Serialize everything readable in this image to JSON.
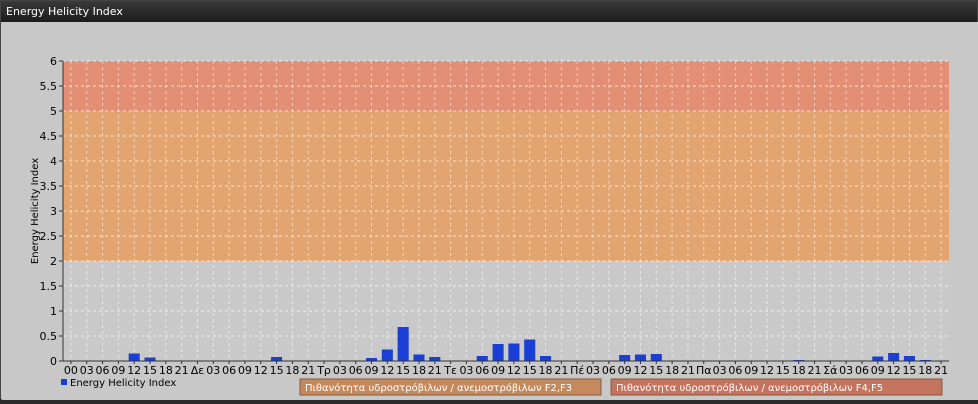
{
  "window": {
    "title": "Energy Helicity Index"
  },
  "chart_data": {
    "type": "bar",
    "title": "",
    "ylabel": "Energy Helicity Index",
    "xlabel": "",
    "ylim": [
      0,
      6
    ],
    "yticks": [
      "0",
      "0.5",
      "1",
      "1.5",
      "2",
      "2.5",
      "3",
      "3.5",
      "4",
      "4.5",
      "5",
      "5.5",
      "6"
    ],
    "categories": [
      "00",
      "03",
      "06",
      "09",
      "12",
      "15",
      "18",
      "21",
      "Δε",
      "03",
      "06",
      "09",
      "12",
      "15",
      "18",
      "21",
      "Τρ",
      "03",
      "06",
      "09",
      "12",
      "15",
      "18",
      "21",
      "Τε",
      "03",
      "06",
      "09",
      "12",
      "15",
      "18",
      "21",
      "Πέ",
      "03",
      "06",
      "09",
      "12",
      "15",
      "18",
      "21",
      "Πα",
      "03",
      "06",
      "09",
      "12",
      "15",
      "18",
      "21",
      "Σά",
      "03",
      "06",
      "09",
      "12",
      "15",
      "18",
      "21"
    ],
    "series": [
      {
        "name": "Energy Helicity Index",
        "color": "#1a3fd6",
        "values": [
          0.01,
          0.01,
          0.01,
          0.01,
          0.15,
          0.07,
          0.01,
          0.01,
          0.01,
          0.01,
          0.01,
          0.01,
          0.01,
          0.08,
          0.01,
          0.01,
          0.01,
          0.01,
          0.01,
          0.06,
          0.23,
          0.68,
          0.13,
          0.08,
          0.01,
          0.01,
          0.1,
          0.34,
          0.35,
          0.43,
          0.1,
          0.01,
          0.01,
          0.01,
          0.01,
          0.12,
          0.13,
          0.14,
          0.01,
          0.01,
          0.01,
          0.01,
          0.01,
          0.01,
          0.01,
          0.01,
          0.02,
          0.01,
          0.01,
          0.01,
          0.01,
          0.09,
          0.16,
          0.1,
          0.02,
          0.01
        ]
      }
    ],
    "bands": [
      {
        "from": 2,
        "to": 5,
        "color": "#e4a269",
        "label": "Πιθανότητα υδροστρόβιλων / ανεμοστρόβιλων F2,F3"
      },
      {
        "from": 5,
        "to": 6,
        "color": "#e58a6e",
        "label": "Πιθανότητα υδροστρόβιλων / ανεμοστρόβιλων F4,F5"
      }
    ],
    "plot_bg": "#c9c9c9",
    "grid": true,
    "legend": "bottom-left"
  }
}
